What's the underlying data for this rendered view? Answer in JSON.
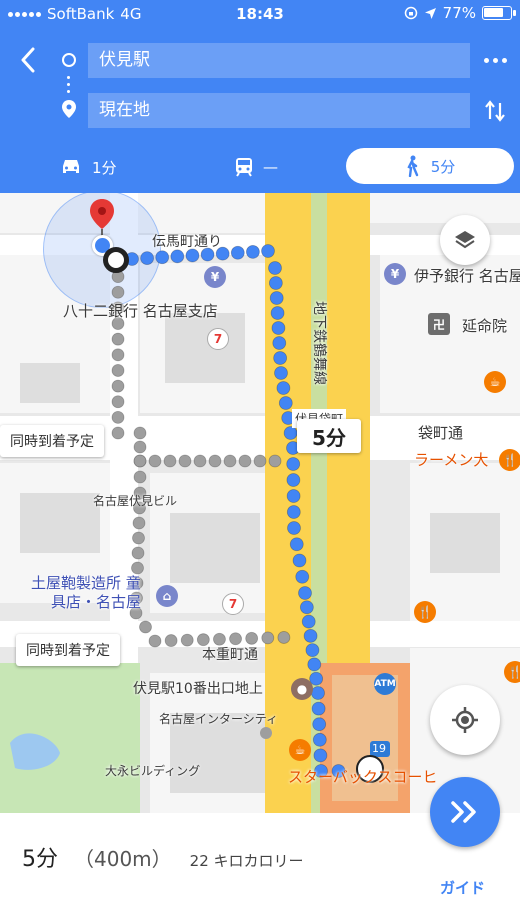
{
  "status_bar": {
    "carrier": "SoftBank",
    "network": "4G",
    "time": "18:43",
    "battery": "77%",
    "battery_level": 0.77
  },
  "directions": {
    "origin": "伏見駅",
    "destination": "現在地"
  },
  "modes": {
    "drive": "1分",
    "transit": "—",
    "walk": "5分"
  },
  "map": {
    "labels": {
      "denmacho": "伝馬町通り",
      "bank": "八十二銀行 名古屋支店",
      "subway": "地下鉄鶴舞線",
      "iyo_bank": "伊予銀行 名古屋",
      "enmeiin": "延命院",
      "fushimi_town": "伏見袋町",
      "fukuro": "袋町通",
      "ramen": "ラーメン大",
      "fushimi_bldg": "名古屋伏見ビル",
      "tsuchiya_1": "土屋鞄製造所 童",
      "tsuchiya_2": "具店・名古屋",
      "motoshige": "本重町通",
      "exit10": "伏見駅10番出口地上",
      "intercity": "名古屋インターシティ",
      "daiei": "大永ビルディング",
      "starbucks": "スターバックスコーヒ",
      "atm": "ATM",
      "route19": "19"
    },
    "callouts": {
      "same_arrival_1": "同時到着予定",
      "same_arrival_2": "同時到着予定",
      "duration": "5分"
    }
  },
  "summary": {
    "duration": "5分",
    "distance": "（400m）",
    "calories": "22 キロカロリー",
    "guide": "ガイド"
  },
  "colors": {
    "header_blue": "#4285f4",
    "route_blue": "#4285f4",
    "alt_route_gray": "#9e9e9e",
    "main_road_yellow": "#fbd24f",
    "park_green": "#c7e6b5",
    "station_orange": "#f4a36b"
  },
  "icons": {
    "back": "chevron-left-icon",
    "more": "more-horizontal-icon",
    "swap": "swap-vertical-icon",
    "drive": "car-icon",
    "transit": "train-icon",
    "walk": "walking-icon",
    "layers": "layers-icon",
    "my_location": "my-location-icon",
    "navigate": "double-chevron-right-icon"
  }
}
